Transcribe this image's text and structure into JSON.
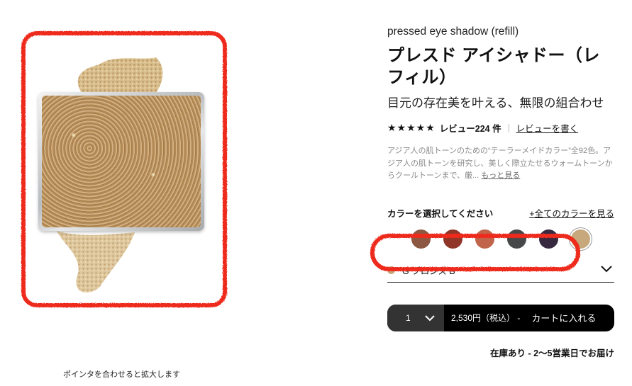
{
  "product": {
    "subtitle_en": "pressed eye shadow (refill)",
    "title": "プレスド アイシャドー（レフィル）",
    "tagline": "目元の存在美を叶える、無限の組合わせ"
  },
  "rating": {
    "stars": "★★★★★",
    "reviews": "レビュー224 件",
    "write_review": "レビューを書く"
  },
  "description": {
    "text": "アジア人の肌トーンのための“テーラーメイドカラー”全92色。アジア人の肌トーンを研究し、美しく際立たせるウォームトーンからクールトーンまで、厳...",
    "more": "もっと見る"
  },
  "color_select": {
    "label": "カラーを選択してください",
    "all_colors": "+全てのカラーを見る",
    "selected_name": "G ブロンズ B",
    "selected_color": "#c6a87c",
    "swatches": [
      {
        "name": "brown",
        "color": "#8c5842"
      },
      {
        "name": "red",
        "color": "#8f3629"
      },
      {
        "name": "terracotta",
        "color": "#c0644b"
      },
      {
        "name": "charcoal",
        "color": "#464849"
      },
      {
        "name": "plum",
        "color": "#372a40"
      },
      {
        "name": "bronze",
        "color": "#c6a87c"
      }
    ]
  },
  "cart": {
    "quantity": "1",
    "price": "2,530円（税込） -",
    "cta": "カートに入れる"
  },
  "stock": "在庫あり - 2〜5営業日でお届け",
  "image_caption": "ポインタを合わせると拡大します",
  "accent": "#ee2a1a"
}
